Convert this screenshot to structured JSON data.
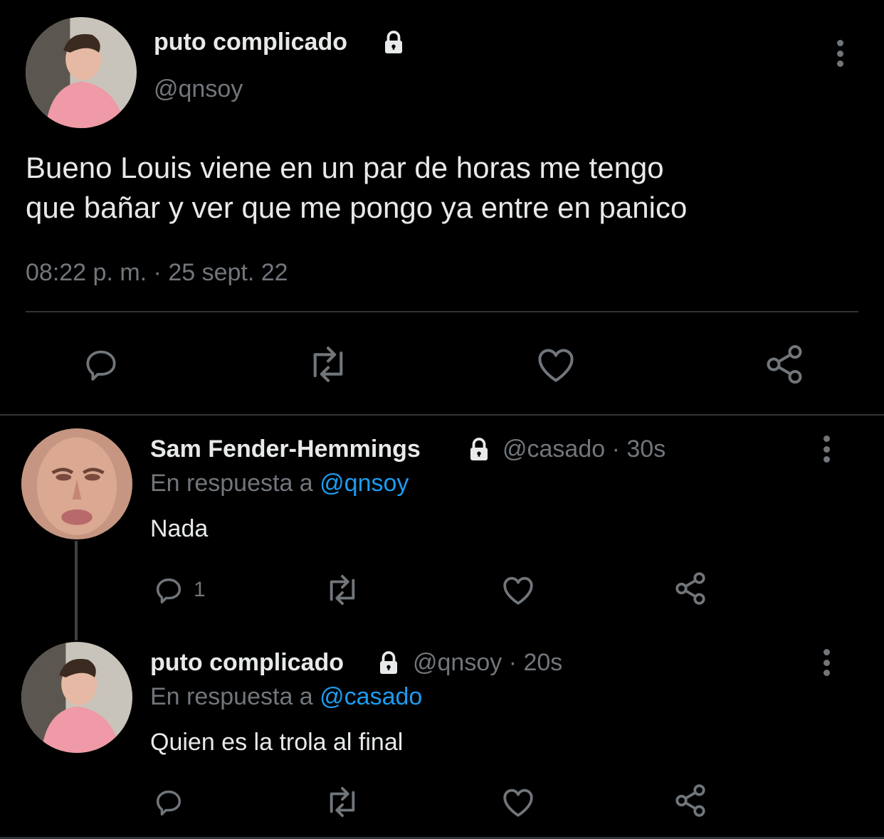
{
  "main_tweet": {
    "display_name": "puto complicado",
    "handle": "@qnsoy",
    "text_line1": "Bueno Louis viene en un par de horas me tengo",
    "text_line2": "que bañar y ver que me pongo ya entre en panico",
    "timestamp": "08:22 p. m. · 25 sept. 22",
    "actions": [
      "reply-icon",
      "retweet-icon",
      "like-icon",
      "share-icon"
    ]
  },
  "replies": [
    {
      "display_name": "Sam Fender-Hemmings",
      "handle": "@casado",
      "time": "· 30s",
      "reply_prefix": "En respuesta a",
      "reply_to": "@qnsoy",
      "text": "Nada",
      "reply_count": "1"
    },
    {
      "display_name": "puto complicado",
      "handle": "@qnsoy",
      "time": "· 20s",
      "reply_prefix": "En respuesta a",
      "reply_to": "@casado",
      "text": "Quien es la trola al final",
      "reply_count": ""
    }
  ],
  "colors": {
    "background": "#000000",
    "text": "#e7e9ea",
    "muted": "#71767b",
    "link": "#1d9bf0",
    "divider": "#2f3336"
  }
}
